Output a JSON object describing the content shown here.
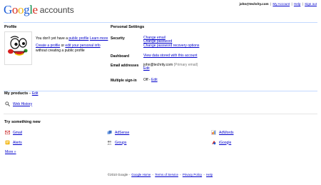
{
  "header": {
    "logo": "Google",
    "product": "accounts",
    "email": "john@techrity.com",
    "my_account": "My Account",
    "help": "Help",
    "sign_out": "Sign out"
  },
  "profile": {
    "heading": "Profile",
    "no_public_pre": "You don't yet have a ",
    "public_profile_link": "public profile",
    "learn_more": "Learn more",
    "create_link": "Create a profile",
    "or_text": " or ",
    "edit_link": "edit your personal info",
    "without_text": "without creating a public profile"
  },
  "settings": {
    "heading": "Personal Settings",
    "security_label": "Security",
    "change_email": "Change email",
    "change_password": "Change password",
    "change_recovery": "Change password recovery options",
    "dashboard_label": "Dashboard",
    "dashboard_link": "View data stored with this account",
    "email_label": "Email addresses",
    "email_value": "john@techrity.com",
    "primary_email": "(Primary email)",
    "email_edit": "Edit",
    "multi_label": "Multiple sign-in",
    "multi_value": "Off",
    "multi_edit": "Edit"
  },
  "my_products": {
    "heading": "My products",
    "edit": "Edit",
    "items": [
      {
        "label": "Web History",
        "icon": "magnifier-icon"
      }
    ]
  },
  "try_new": {
    "heading": "Try something new",
    "items": [
      {
        "label": "Gmail",
        "icon": "gmail-icon"
      },
      {
        "label": "AdSense",
        "icon": "adsense-icon"
      },
      {
        "label": "AdWords",
        "icon": "adwords-icon"
      },
      {
        "label": "Alerts",
        "icon": "alerts-icon"
      },
      {
        "label": "Groups",
        "icon": "groups-icon"
      },
      {
        "label": "iGoogle",
        "icon": "igoogle-icon"
      }
    ],
    "more": "More »"
  },
  "footer": {
    "copyright": "©2010 Google",
    "home": "Google Home",
    "terms": "Terms of Service",
    "privacy": "Privacy Policy",
    "help": "Help"
  },
  "colors": {
    "link": "#0000cc",
    "rule": "#c3d9ff"
  }
}
